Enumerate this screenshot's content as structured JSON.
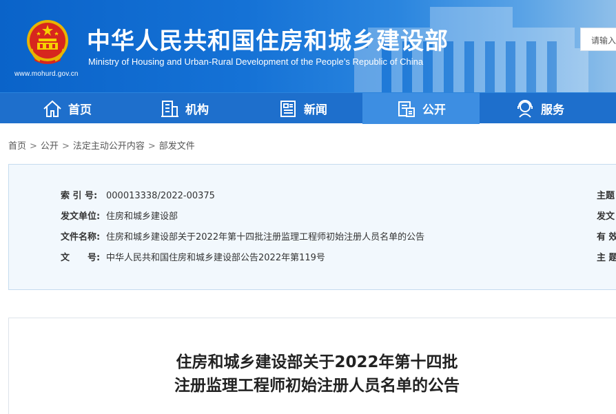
{
  "header": {
    "title_cn": "中华人民共和国住房和城乡建设部",
    "title_en": "Ministry of Housing and Urban-Rural Development of the People’s Republic of China",
    "site_url": "www.mohurd.gov.cn",
    "search_placeholder": "请输入"
  },
  "nav": {
    "items": [
      {
        "label": "首页",
        "icon": "home-icon"
      },
      {
        "label": "机构",
        "icon": "building-icon"
      },
      {
        "label": "新闻",
        "icon": "newspaper-icon"
      },
      {
        "label": "公开",
        "icon": "document-icon"
      },
      {
        "label": "服务",
        "icon": "service-icon"
      }
    ],
    "active_index": 3
  },
  "breadcrumb": [
    "首页",
    "公开",
    "法定主动公开内容",
    "部发文件"
  ],
  "info": {
    "index_label": "索 引 号:",
    "index_value": "000013338/2022-00375",
    "issuer_label": "发文单位:",
    "issuer_value": "住房和城乡建设部",
    "docname_label": "文件名称:",
    "docname_value": "住房和城乡建设部关于2022年第十四批注册监理工程师初始注册人员名单的公告",
    "docno_label": "文　　号:",
    "docno_value": "中华人民共和国住房和城乡建设部公告2022年第119号",
    "right_labels": [
      "主题",
      "发文",
      "有 效",
      "主 题"
    ]
  },
  "article": {
    "title_line1": "住房和城乡建设部关于2022年第十四批",
    "title_line2": "注册监理工程师初始注册人员名单的公告"
  },
  "colors": {
    "banner": "#1572d6",
    "nav": "#1e6fcc",
    "nav_active": "#3d8ee2",
    "panel_bg": "#f2f8fd",
    "panel_border": "#c5dbef"
  }
}
